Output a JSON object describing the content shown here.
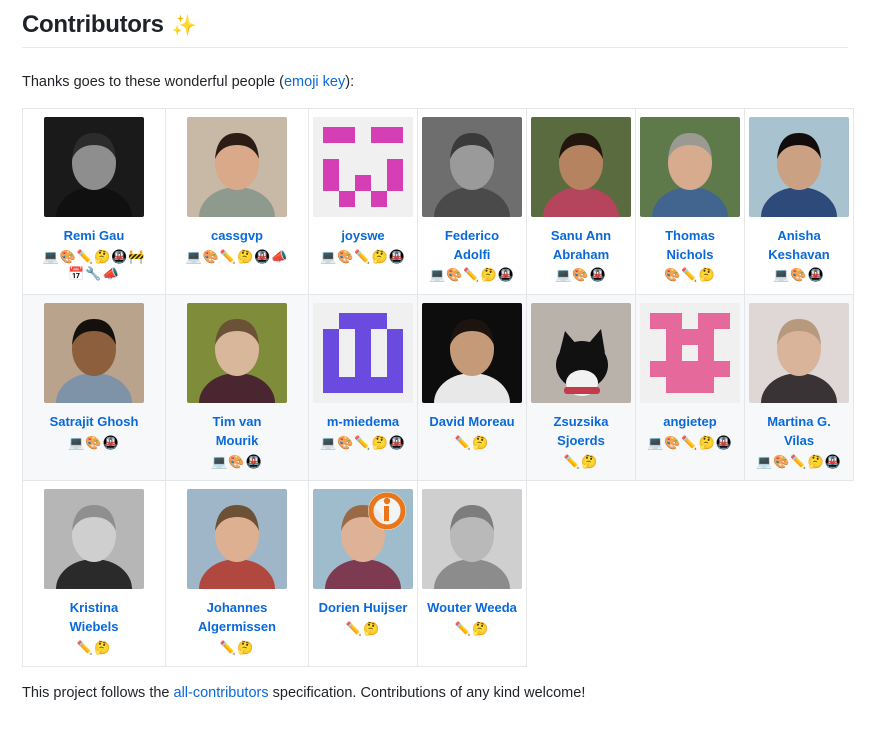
{
  "heading": {
    "title": "Contributors",
    "sparkle_emoji": "✨"
  },
  "intro": {
    "before_link": "Thanks goes to these wonderful people (",
    "link_label": "emoji key",
    "after_link": "):"
  },
  "footer": {
    "before_link": "This project follows the ",
    "link_label": "all-contributors",
    "after_link": " specification. Contributions of any kind welcome!"
  },
  "colors": {
    "link": "#0969da",
    "text": "#1f2328",
    "cell_border": "#e4e6ea",
    "alt_row_bg": "#f7f8fa",
    "rule": "#e8ebee"
  },
  "emoji_legend": {
    "laptop": "💻",
    "palette": "🎨",
    "pencil": "✏️",
    "thinking": "🤔",
    "metro": "🚇",
    "construction": "🚧",
    "calendar": "📅",
    "wrench": "🔧",
    "megaphone": "📣"
  },
  "rows": [
    {
      "alt": false,
      "cells": [
        {
          "name": "Remi Gau",
          "avatar": {
            "kind": "photo",
            "id": "remi-gau"
          },
          "badges": [
            "💻",
            "🎨",
            "✏️",
            "🤔",
            "🚇",
            "🚧",
            "📅",
            "🔧",
            "📣"
          ]
        },
        {
          "name": "cassgvp",
          "avatar": {
            "kind": "photo",
            "id": "cassgvp"
          },
          "badges": [
            "💻",
            "🎨",
            "✏️",
            "🤔",
            "🚇",
            "📣"
          ]
        },
        {
          "name": "joyswe",
          "avatar": {
            "kind": "identicon",
            "color": "#d43fb5",
            "bg": "#f0f0f0",
            "seed": "joyswe"
          },
          "badges": [
            "💻",
            "🎨",
            "✏️",
            "🤔",
            "🚇"
          ]
        },
        {
          "name": "Federico Adolfi",
          "avatar": {
            "kind": "photo",
            "id": "federico-adolfi"
          },
          "badges": [
            "💻",
            "🎨",
            "✏️",
            "🤔",
            "🚇"
          ]
        },
        {
          "name": "Sanu Ann Abraham",
          "avatar": {
            "kind": "photo",
            "id": "sanu-ann-abraham"
          },
          "badges": [
            "💻",
            "🎨",
            "🚇"
          ]
        },
        {
          "name": "Thomas Nichols",
          "avatar": {
            "kind": "photo",
            "id": "thomas-nichols"
          },
          "badges": [
            "🎨",
            "✏️",
            "🤔"
          ]
        },
        {
          "name": "Anisha Keshavan",
          "avatar": {
            "kind": "photo",
            "id": "anisha-keshavan"
          },
          "badges": [
            "💻",
            "🎨",
            "🚇"
          ]
        }
      ]
    },
    {
      "alt": true,
      "cells": [
        {
          "name": "Satrajit Ghosh",
          "avatar": {
            "kind": "photo",
            "id": "satrajit-ghosh"
          },
          "badges": [
            "💻",
            "🎨",
            "🚇"
          ]
        },
        {
          "name": "Tim van Mourik",
          "avatar": {
            "kind": "photo",
            "id": "tim-van-mourik"
          },
          "badges": [
            "💻",
            "🎨",
            "🚇"
          ]
        },
        {
          "name": "m-miedema",
          "avatar": {
            "kind": "identicon",
            "color": "#6b4ae0",
            "bg": "#f0f0f0",
            "seed": "m-miedema"
          },
          "badges": [
            "💻",
            "🎨",
            "✏️",
            "🤔",
            "🚇"
          ]
        },
        {
          "name": "David Moreau",
          "avatar": {
            "kind": "photo",
            "id": "david-moreau"
          },
          "badges": [
            "✏️",
            "🤔"
          ]
        },
        {
          "name": "Zsuzsika Sjoerds",
          "avatar": {
            "kind": "photo",
            "id": "zsuzsika-sjoerds"
          },
          "badges": [
            "✏️",
            "🤔"
          ]
        },
        {
          "name": "angietep",
          "avatar": {
            "kind": "identicon",
            "color": "#e56a9b",
            "bg": "#f0f0f0",
            "seed": "angietep"
          },
          "badges": [
            "💻",
            "🎨",
            "✏️",
            "🤔",
            "🚇"
          ]
        },
        {
          "name": "Martina G. Vilas",
          "avatar": {
            "kind": "photo",
            "id": "martina-g-vilas"
          },
          "badges": [
            "💻",
            "🎨",
            "✏️",
            "🤔",
            "🚇"
          ]
        }
      ]
    },
    {
      "alt": false,
      "cells": [
        {
          "name": "Kristina Wiebels",
          "avatar": {
            "kind": "photo",
            "id": "kristina-wiebels"
          },
          "badges": [
            "✏️",
            "🤔"
          ]
        },
        {
          "name": "Johannes Algermissen",
          "avatar": {
            "kind": "photo",
            "id": "johannes-algermissen"
          },
          "badges": [
            "✏️",
            "🤔"
          ]
        },
        {
          "name": "Dorien Huijser",
          "avatar": {
            "kind": "photo",
            "id": "dorien-huijser"
          },
          "badges": [
            "✏️",
            "🤔"
          ]
        },
        {
          "name": "Wouter Weeda",
          "avatar": {
            "kind": "photo",
            "id": "wouter-weeda"
          },
          "badges": [
            "✏️",
            "🤔"
          ]
        }
      ]
    }
  ]
}
